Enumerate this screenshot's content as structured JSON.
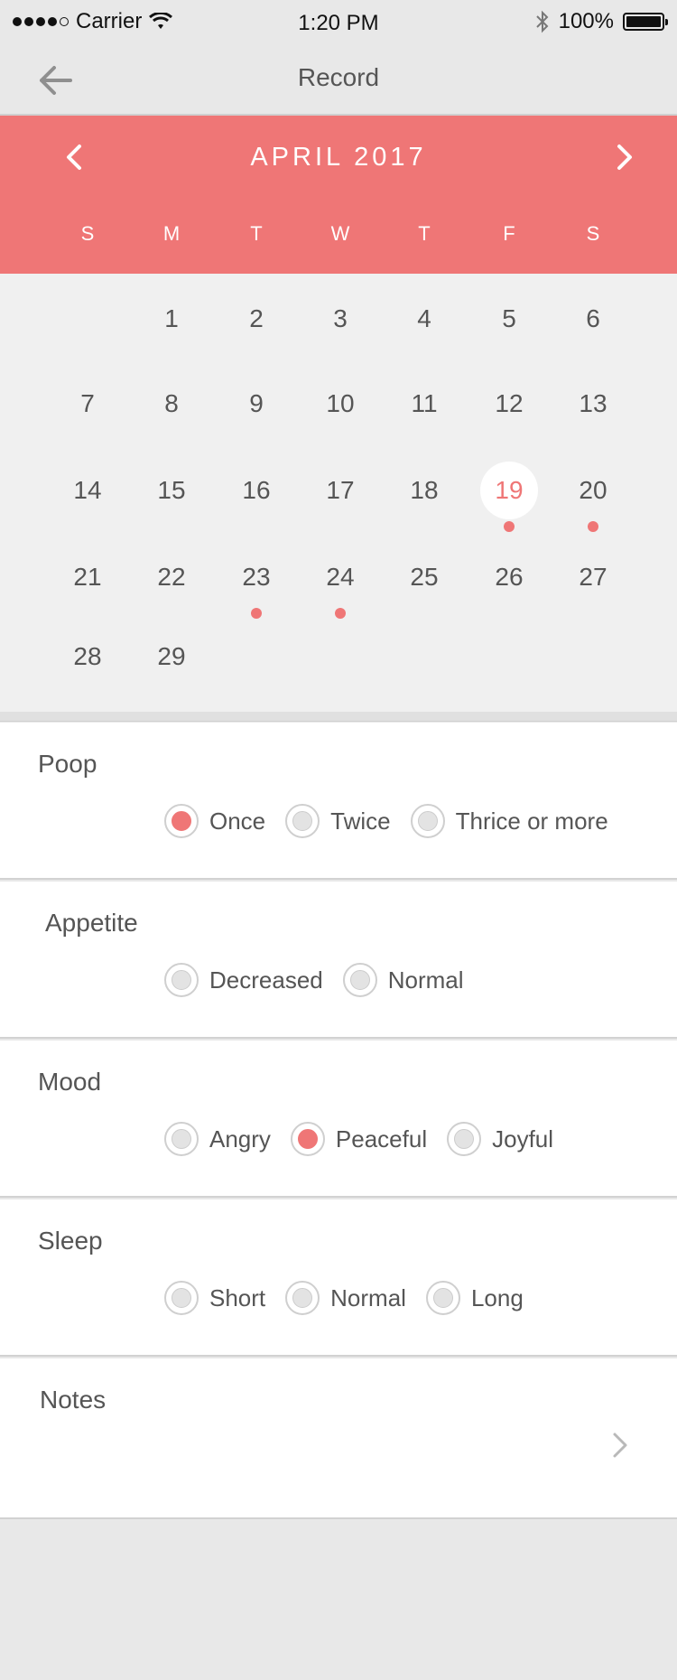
{
  "status_bar": {
    "carrier": "Carrier",
    "time": "1:20 PM",
    "battery": "100%"
  },
  "nav": {
    "title": "Record",
    "back_icon": "arrow-left-icon"
  },
  "calendar": {
    "month_label": "APRIL 2017",
    "weekdays": [
      "S",
      "M",
      "T",
      "W",
      "T",
      "F",
      "S"
    ],
    "days": [
      "1",
      "2",
      "3",
      "4",
      "5",
      "6",
      "7",
      "8",
      "9",
      "10",
      "11",
      "12",
      "13",
      "14",
      "15",
      "16",
      "17",
      "18",
      "19",
      "20",
      "21",
      "22",
      "23",
      "24",
      "25",
      "26",
      "27",
      "28",
      "29"
    ],
    "selected_day": "19",
    "days_with_records": [
      "19",
      "20",
      "23",
      "24"
    ],
    "accent_color": "#ef7676"
  },
  "sections": {
    "poop": {
      "label": "Poop",
      "options": [
        "Once",
        "Twice",
        "Thrice or more"
      ],
      "selected": "Once"
    },
    "appetite": {
      "label": "Appetite",
      "options": [
        "Decreased",
        "Normal"
      ],
      "selected": ""
    },
    "mood": {
      "label": "Mood",
      "options": [
        "Angry",
        "Peaceful",
        "Joyful"
      ],
      "selected": "Peaceful"
    },
    "sleep": {
      "label": "Sleep",
      "options": [
        "Short",
        "Normal",
        "Long"
      ],
      "selected": ""
    },
    "notes": {
      "label": "Notes",
      "icon": "chevron-right-icon"
    }
  }
}
